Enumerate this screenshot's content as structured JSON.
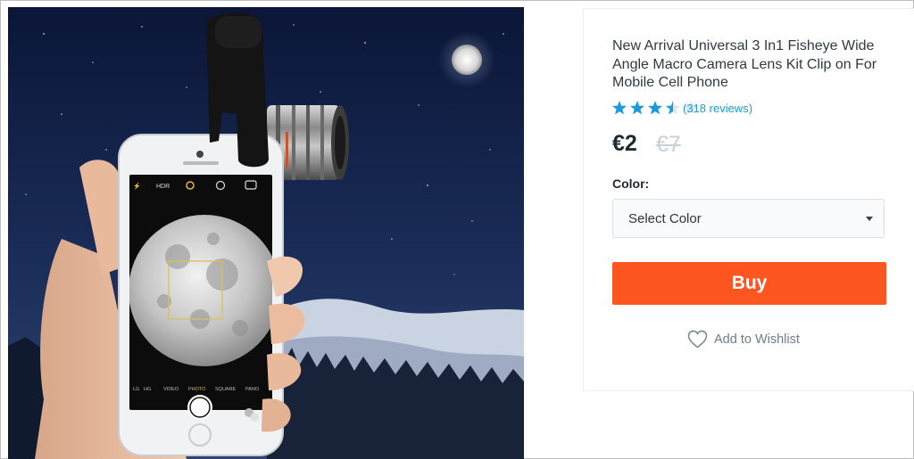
{
  "product": {
    "title": "New Arrival Universal 3 In1 Fisheye Wide Angle Macro Camera Lens Kit Clip on For Mobile Cell Phone",
    "image_icon": "product-photo",
    "rating": 3.5,
    "rating_max": 5,
    "reviews_label": "(318 reviews)",
    "price": "€2",
    "old_price": "€7"
  },
  "phone_screen": {
    "modes": [
      "LG",
      "HG",
      "VIDEO",
      "PHOTO",
      "SQUARE",
      "PANO"
    ],
    "top_icons": [
      "flash-icon",
      "hdr-icon",
      "live-icon",
      "timer-icon",
      "flip-camera-icon"
    ],
    "hdr_text": "HDR"
  },
  "options": {
    "color_label": "Color:",
    "select_placeholder": "Select Color"
  },
  "actions": {
    "buy_label": "Buy",
    "wishlist_label": "Add to Wishlist"
  },
  "colors": {
    "accent": "#fe5621",
    "link": "#1b9bdb",
    "star_filled": "#1b9bdb",
    "star_empty": "#dfe4e8"
  }
}
